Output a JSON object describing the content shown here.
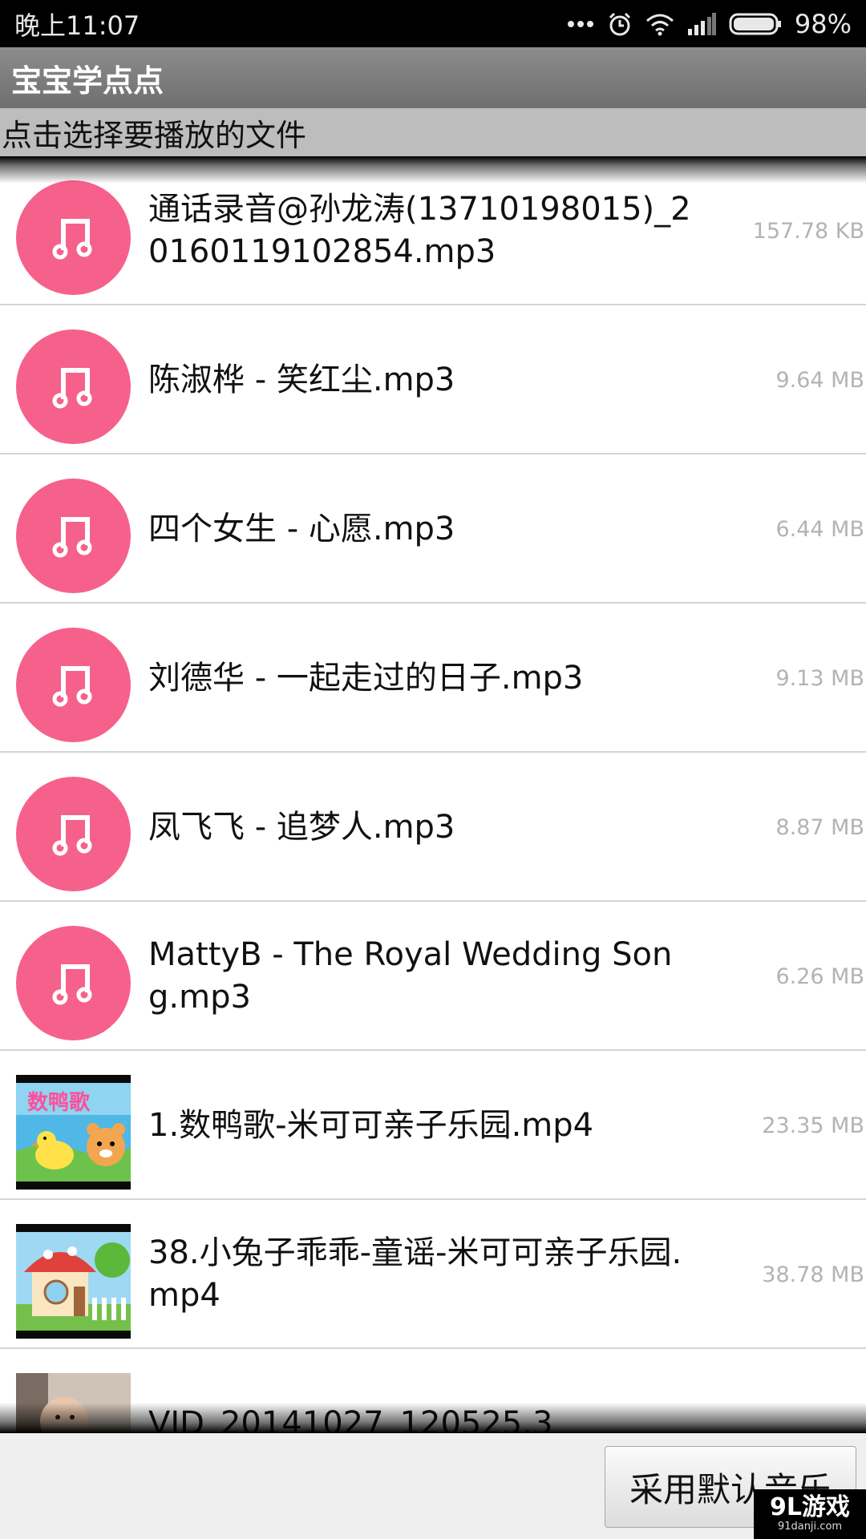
{
  "status_bar": {
    "time": "晚上11:07",
    "battery": "98%",
    "icons": [
      "more-dots-icon",
      "alarm-icon",
      "wifi-icon",
      "signal-icon",
      "battery-icon"
    ]
  },
  "app": {
    "title": "宝宝学点点"
  },
  "subtitle": "点击选择要播放的文件",
  "files": [
    {
      "name": "通话录音@孙龙涛(13710198015)_20160119102854.mp3",
      "size": "157.78 KB",
      "thumb": "music-icon"
    },
    {
      "name": "陈淑桦 - 笑红尘.mp3",
      "size": "9.64 MB",
      "thumb": "music-icon"
    },
    {
      "name": "四个女生 - 心愿.mp3",
      "size": "6.44 MB",
      "thumb": "music-icon"
    },
    {
      "name": "刘德华 - 一起走过的日子.mp3",
      "size": "9.13 MB",
      "thumb": "music-icon"
    },
    {
      "name": "凤飞飞 - 追梦人.mp3",
      "size": "8.87 MB",
      "thumb": "music-icon"
    },
    {
      "name": "MattyB - The Royal Wedding Song.mp3",
      "size": "6.26 MB",
      "thumb": "music-icon"
    },
    {
      "name": "1.数鸭歌-米可可亲子乐园.mp4",
      "size": "23.35 MB",
      "thumb": "video-thumbnail",
      "thumb_caption": "数鸭歌"
    },
    {
      "name": "38.小兔子乖乖-童谣-米可可亲子乐园.mp4",
      "size": "38.78 MB",
      "thumb": "video-thumbnail"
    },
    {
      "name": "VID_20141027_120525.3",
      "size": "",
      "thumb": "video-thumbnail"
    }
  ],
  "footer": {
    "default_button": "采用默认音乐"
  },
  "watermark": {
    "main": "9L游戏",
    "sub": "91danji.com"
  },
  "colors": {
    "accent": "#f6618c",
    "appbar": "#7e7e7e",
    "subtitle_bg": "#bdbdbd"
  }
}
